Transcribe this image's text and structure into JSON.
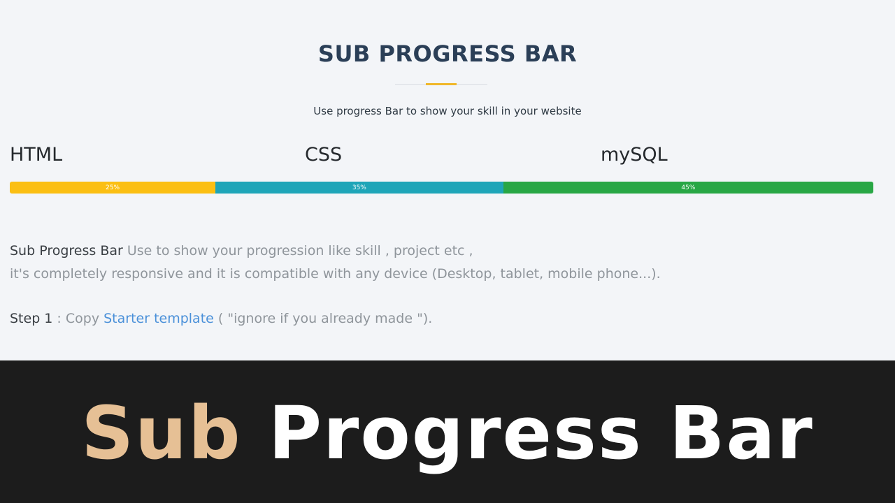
{
  "header": {
    "title": "SUB PROGRESS BAR",
    "subtitle": "Use progress Bar to show your skill in your website"
  },
  "skills": [
    {
      "label": "HTML",
      "percent_label": "25%",
      "value": 25,
      "color": "#fbbf13"
    },
    {
      "label": "CSS",
      "percent_label": "35%",
      "value": 35,
      "color": "#1ea5b8"
    },
    {
      "label": "mySQL",
      "percent_label": "45%",
      "value": 45,
      "color": "#28a745"
    }
  ],
  "description": {
    "strong": "Sub Progress Bar",
    "line1_rest": " Use to show your progression like skill , project etc ,",
    "line2": "it's completely responsive and it is compatible with any device (Desktop, tablet, mobile phone...)."
  },
  "step": {
    "strong": "Step 1",
    "prefix": " : Copy ",
    "link": "Starter template",
    "suffix": " ( \"ignore if you already made \")."
  },
  "banner": {
    "word1": "Sub",
    "word2": "Progress Bar",
    "word1_color": "#e6c095",
    "word2_color": "#ffffff",
    "background": "#1c1c1c"
  },
  "colors": {
    "heading": "#2b3f57",
    "divider_accent": "#f0b72a",
    "link": "#4a90d9"
  }
}
